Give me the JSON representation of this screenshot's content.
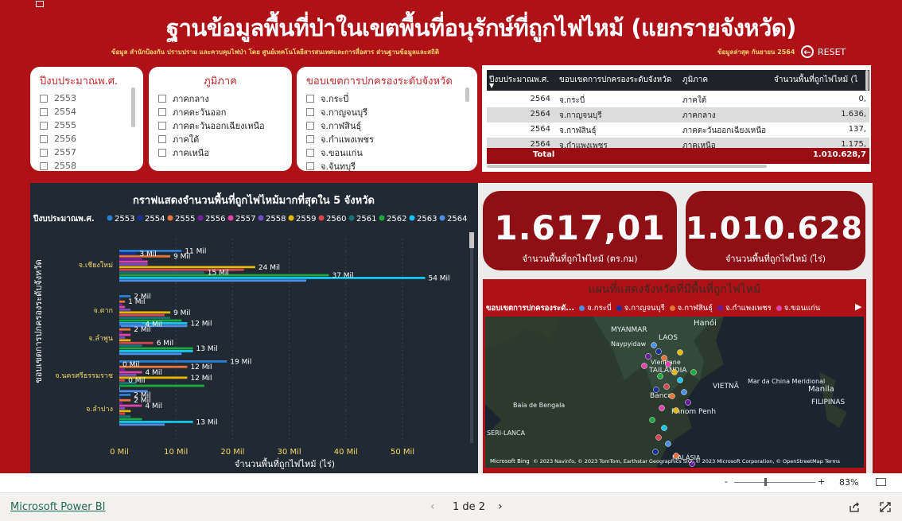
{
  "header": {
    "title": "ฐานข้อมูลพื้นที่ป่าในเขตพื้นที่อนุรักษ์ที่ถูกไฟไหม้ (แยกรายจังหวัด)",
    "source": "ข้อมูล สำนักป้องกัน ปราบปราม และควบคุมไฟป่า โดย ศูนย์เทคโนโลยีสารสนเทศและการสื่อสาร ส่วนฐานข้อมูลและสถิติ",
    "updated": "ข้อมูลล่าสุด กันยายน 2564",
    "reset_label": "RESET"
  },
  "slicers": {
    "year": {
      "title": "ปีงบประมาณพ.ศ.",
      "items": [
        "2553",
        "2554",
        "2555",
        "2556",
        "2557",
        "2558"
      ]
    },
    "region": {
      "title": "ภูมิภาค",
      "items": [
        "ภาคกลาง",
        "ภาคตะวันออก",
        "ภาคตะวันออกเฉียงเหนือ",
        "ภาคใต้",
        "ภาคเหนือ"
      ]
    },
    "province": {
      "title": "ขอบเขตการปกครองระดับจังหวัด",
      "items": [
        "จ.กระบี่",
        "จ.กาญจนบุรี",
        "จ.กาฬสินธุ์",
        "จ.กำแพงเพชร",
        "จ.ขอนแก่น",
        "จ.จันทบุรี"
      ]
    }
  },
  "table": {
    "headers": [
      "ปีงบประมาณพ.ศ.",
      "ขอบเขตการปกครองระดับจังหวัด",
      "ภูมิภาค",
      "จำนวนพื้นที่ถูกไฟไหม้ (ไ"
    ],
    "rows": [
      [
        "2564",
        "จ.กระบี่",
        "ภาคใต้",
        "0,"
      ],
      [
        "2564",
        "จ.กาญจนบุรี",
        "ภาคกลาง",
        "1.636,"
      ],
      [
        "2564",
        "จ.กาฬสินธุ์",
        "ภาคตะวันออกเฉียงเหนือ",
        "137,"
      ],
      [
        "2564",
        "จ.กำแพงเพชร",
        "ภาคเหนือ",
        "1.175,"
      ]
    ],
    "total_label": "Total",
    "total_value": "1.010.628,7"
  },
  "chart": {
    "title": "กราฟแสดงจำนวนพื้นที่ถูกไฟไหม้มากที่สุดใน 5 จังหวัด",
    "legend_title": "ปีงบประมาณพ.ศ."
  },
  "chart_data": {
    "type": "bar",
    "orientation": "horizontal",
    "title": "กราฟแสดงจำนวนพื้นที่ถูกไฟไหม้มากที่สุดใน 5 จังหวัด",
    "xlabel": "จำนวนพื้นที่ถูกไฟไหม้ (ไร่)",
    "ylabel": "ขอบเขตการปกครองระดับจังหวัด",
    "legend_title": "ปีงบประมาณพ.ศ.",
    "legend_position": "top",
    "xlim": [
      0,
      57
    ],
    "xticks": [
      "0 Mil",
      "10 Mil",
      "20 Mil",
      "30 Mil",
      "40 Mil",
      "50 Mil"
    ],
    "categories": [
      "จ.เชียงใหม่",
      "จ.ตาก",
      "จ.ลำพูน",
      "จ.นครศรีธรรมราช",
      "จ.ลำปาง"
    ],
    "series": [
      {
        "name": "2553",
        "color": "#2b7fd4",
        "values": [
          11,
          2,
          4,
          19,
          2
        ]
      },
      {
        "name": "2554",
        "color": "#1a2fa0",
        "values": [
          3,
          0.3,
          0.3,
          0,
          0.3
        ]
      },
      {
        "name": "2555",
        "color": "#e8743b",
        "values": [
          9,
          1,
          2,
          12,
          2
        ]
      },
      {
        "name": "2556",
        "color": "#7b1fa2",
        "values": [
          4,
          0.5,
          0.5,
          1,
          0.5
        ]
      },
      {
        "name": "2557",
        "color": "#e044a7",
        "values": [
          5,
          1,
          2,
          4,
          4
        ]
      },
      {
        "name": "2558",
        "color": "#744ec2",
        "values": [
          5,
          2,
          1,
          3,
          1
        ]
      },
      {
        "name": "2559",
        "color": "#e6b800",
        "values": [
          24,
          9,
          2,
          12,
          2
        ]
      },
      {
        "name": "2560",
        "color": "#d64550",
        "values": [
          22,
          8,
          6,
          1,
          1
        ]
      },
      {
        "name": "2561",
        "color": "#197278",
        "values": [
          15,
          9,
          4,
          3,
          2
        ]
      },
      {
        "name": "2562",
        "color": "#1aab40",
        "values": [
          37,
          11,
          13,
          15,
          4
        ]
      },
      {
        "name": "2563",
        "color": "#15c6f4",
        "values": [
          54,
          12,
          13,
          0,
          13
        ]
      },
      {
        "name": "2564",
        "color": "#4b8fe8",
        "values": [
          33,
          12,
          11,
          5,
          8
        ]
      }
    ],
    "data_labels": [
      {
        "category": "จ.เชียงใหม่",
        "series": "2553",
        "text": "11 Mil"
      },
      {
        "category": "จ.เชียงใหม่",
        "series": "2554",
        "text": "3 Mil"
      },
      {
        "category": "จ.เชียงใหม่",
        "series": "2555",
        "text": "9 Mil"
      },
      {
        "category": "จ.เชียงใหม่",
        "series": "2559",
        "text": "24 Mil"
      },
      {
        "category": "จ.เชียงใหม่",
        "series": "2561",
        "text": "15 Mil"
      },
      {
        "category": "จ.เชียงใหม่",
        "series": "2562",
        "text": "37 Mil"
      },
      {
        "category": "จ.เชียงใหม่",
        "series": "2563",
        "text": "54 Mil"
      },
      {
        "category": "จ.ตาก",
        "series": "2553",
        "text": "2 Mil"
      },
      {
        "category": "จ.ตาก",
        "series": "2555",
        "text": "1 Mil"
      },
      {
        "category": "จ.ตาก",
        "series": "2559",
        "text": "9 Mil"
      },
      {
        "category": "จ.ตาก",
        "series": "2563",
        "text": "12 Mil"
      },
      {
        "category": "จ.ลำพูน",
        "series": "2553",
        "text": "4 Mil"
      },
      {
        "category": "จ.ลำพูน",
        "series": "2555",
        "text": "2 Mil"
      },
      {
        "category": "จ.ลำพูน",
        "series": "2560",
        "text": "6 Mil"
      },
      {
        "category": "จ.ลำพูน",
        "series": "2562",
        "text": "13 Mil"
      },
      {
        "category": "จ.นครศรีธรรมราช",
        "series": "2553",
        "text": "19 Mil"
      },
      {
        "category": "จ.นครศรีธรรมราช",
        "series": "2554",
        "text": "0 Mil"
      },
      {
        "category": "จ.นครศรีธรรมราช",
        "series": "2555",
        "text": "12 Mil"
      },
      {
        "category": "จ.นครศรีธรรมราช",
        "series": "2557",
        "text": "4 Mil"
      },
      {
        "category": "จ.นครศรีธรรมราช",
        "series": "2559",
        "text": "12 Mil"
      },
      {
        "category": "จ.นครศรีธรรมราช",
        "series": "2560",
        "text": "0 Mil"
      },
      {
        "category": "จ.ลำปาง",
        "series": "2553",
        "text": "2 Mil"
      },
      {
        "category": "จ.ลำปาง",
        "series": "2555",
        "text": "2 Mil"
      },
      {
        "category": "จ.ลำปาง",
        "series": "2557",
        "text": "4 Mil"
      },
      {
        "category": "จ.ลำปาง",
        "series": "2563",
        "text": "13 Mil"
      }
    ]
  },
  "kpis": [
    {
      "value": "1.617,01",
      "label": "จำนวนพื้นที่ถูกไฟไหม้ (ตร.กม)"
    },
    {
      "value": "1.010.628...",
      "label": "จำนวนพื้นที่ถูกไฟไหม้ (ไร่)"
    }
  ],
  "map": {
    "title": "แผนที่แสดงจังหวัดที่มีพื้นที่ถูกไฟไหม้",
    "legend_title": "ขอบเขตการปกครองระดั...",
    "legend_items": [
      {
        "label": "จ.กระบี่",
        "color": "#4b8fe8"
      },
      {
        "label": "จ.กาญจนบุรี",
        "color": "#1a2fa0"
      },
      {
        "label": "จ.กาฬสินธุ์",
        "color": "#e8743b"
      },
      {
        "label": "จ.กำแพงเพชร",
        "color": "#6a1b9a"
      },
      {
        "label": "จ.ขอนแก่น",
        "color": "#e044a7"
      }
    ],
    "places": [
      {
        "name": "MYANMAR"
      },
      {
        "name": "Hanói"
      },
      {
        "name": "Naypyidaw"
      },
      {
        "name": "LAOS"
      },
      {
        "name": "Vientiane"
      },
      {
        "name": "TAILÂNDIA"
      },
      {
        "name": "Banco"
      },
      {
        "name": "VIETNÃ"
      },
      {
        "name": "Phnom Penh"
      },
      {
        "name": "Mar da China Meridional"
      },
      {
        "name": "Manila"
      },
      {
        "name": "FILIPINAS"
      },
      {
        "name": "Baía de Bengala"
      },
      {
        "name": "SERI-LANCA"
      },
      {
        "name": "MALÁSIA"
      }
    ],
    "bing_label": "Microsoft Bing",
    "attribution": "© 2023 Navinfo, © 2023 TomTom, Earthstar Geographics SIO, © 2023 Microsoft Corporation, © OpenStreetMap  Terms"
  },
  "statusbar": {
    "zoom": "83%",
    "zoom_minus": "-",
    "zoom_plus": "+"
  },
  "footer": {
    "brand": "Microsoft Power BI",
    "page": "1 de 2"
  },
  "colors": {
    "canvas": "#ae1116",
    "chart_bg": "#212933",
    "accent_yellow": "#f5d76e",
    "kpi_bg": "#8e1015"
  }
}
